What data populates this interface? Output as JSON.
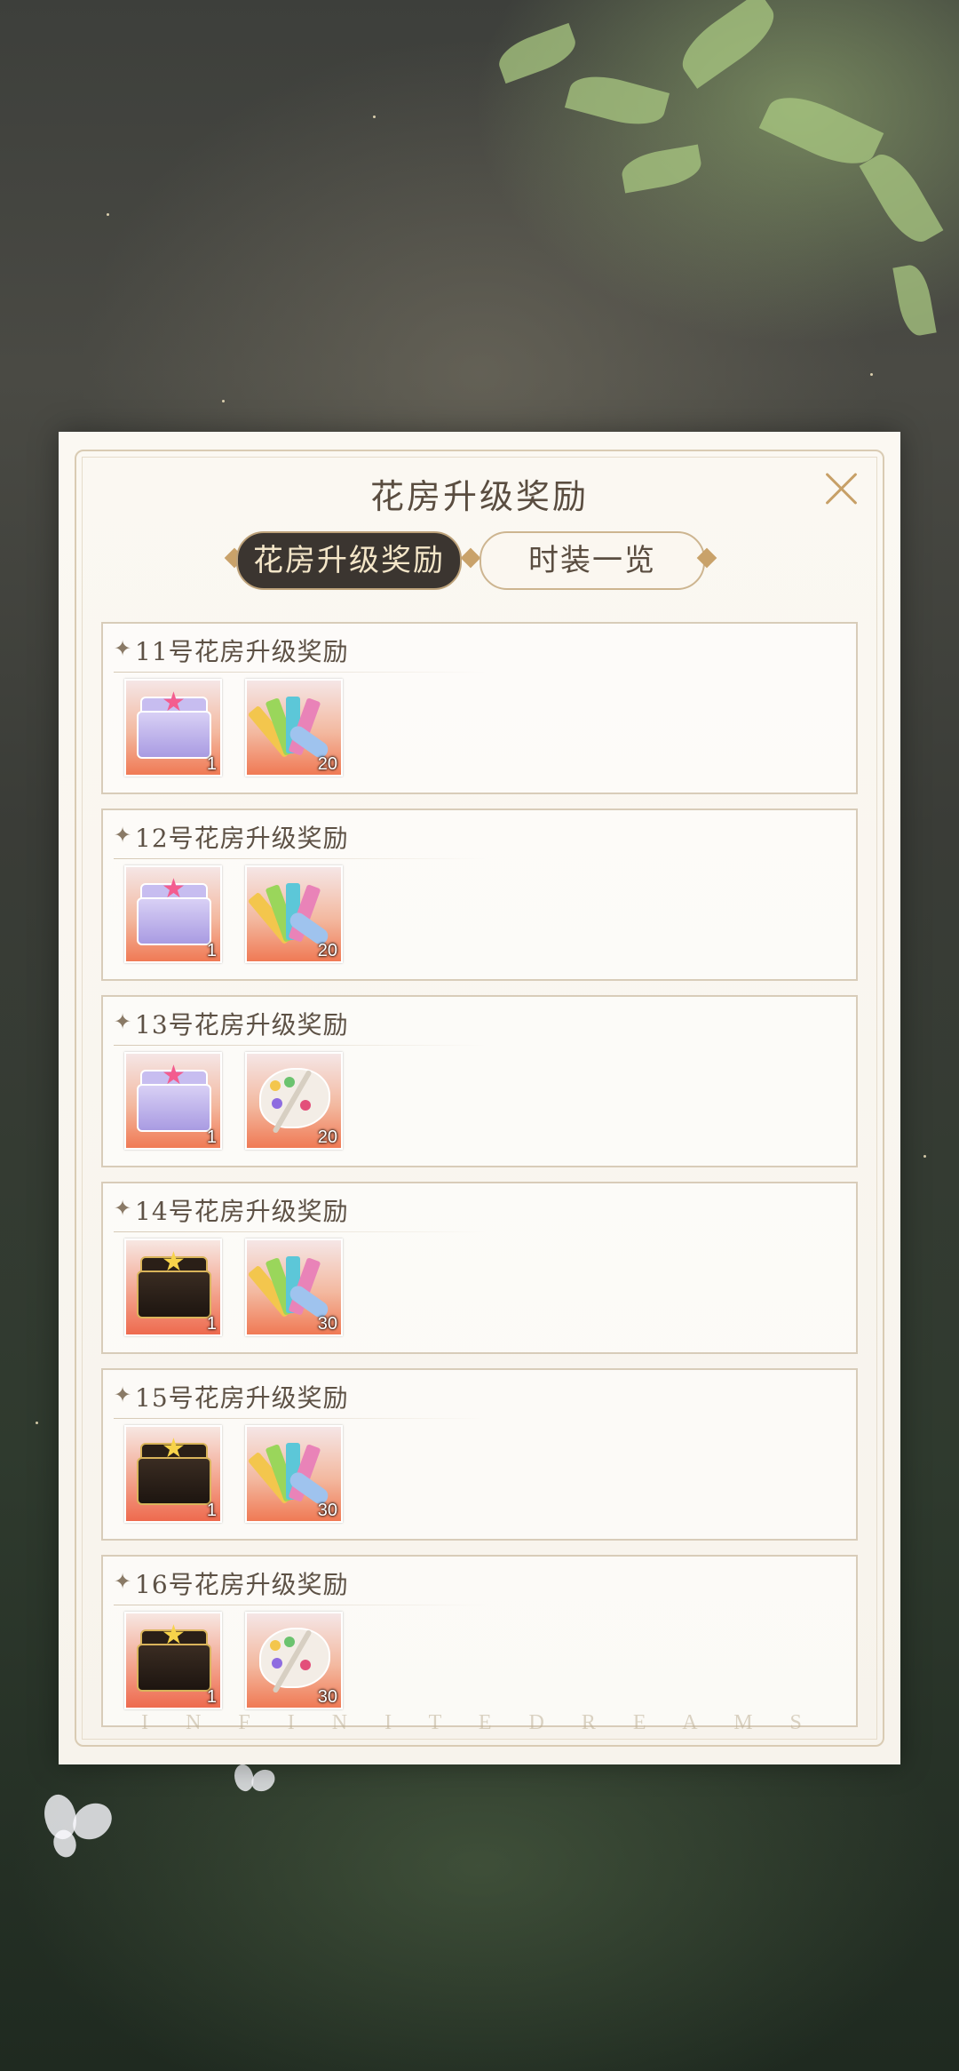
{
  "dialog": {
    "title": "花房升级奖励",
    "tabs": [
      {
        "label": "花房升级奖励",
        "active": true
      },
      {
        "label": "时装一览",
        "active": false
      }
    ],
    "footer_text": "I N F I N I T E D R E A M S"
  },
  "rewards": [
    {
      "title": "11号花房升级奖励",
      "items": [
        {
          "icon": "purple-star-chest-icon",
          "count": "1"
        },
        {
          "icon": "color-swatch-tickets-icon",
          "count": "20"
        }
      ]
    },
    {
      "title": "12号花房升级奖励",
      "items": [
        {
          "icon": "purple-star-chest-icon",
          "count": "1"
        },
        {
          "icon": "color-swatch-tickets-icon",
          "count": "20"
        }
      ]
    },
    {
      "title": "13号花房升级奖励",
      "items": [
        {
          "icon": "purple-star-chest-icon",
          "count": "1"
        },
        {
          "icon": "paint-palette-icon",
          "count": "20"
        }
      ]
    },
    {
      "title": "14号花房升级奖励",
      "items": [
        {
          "icon": "gold-star-chest-icon",
          "count": "1"
        },
        {
          "icon": "color-swatch-tickets-icon",
          "count": "30"
        }
      ]
    },
    {
      "title": "15号花房升级奖励",
      "items": [
        {
          "icon": "gold-star-chest-icon",
          "count": "1"
        },
        {
          "icon": "color-swatch-tickets-icon",
          "count": "30"
        }
      ]
    },
    {
      "title": "16号花房升级奖励",
      "items": [
        {
          "icon": "gold-star-chest-icon",
          "count": "1"
        },
        {
          "icon": "paint-palette-icon",
          "count": "30"
        }
      ]
    }
  ],
  "colors": {
    "accent_gold": "#c7a067",
    "tab_active_bg": "#3b3530",
    "text_brown": "#5a4d40"
  }
}
